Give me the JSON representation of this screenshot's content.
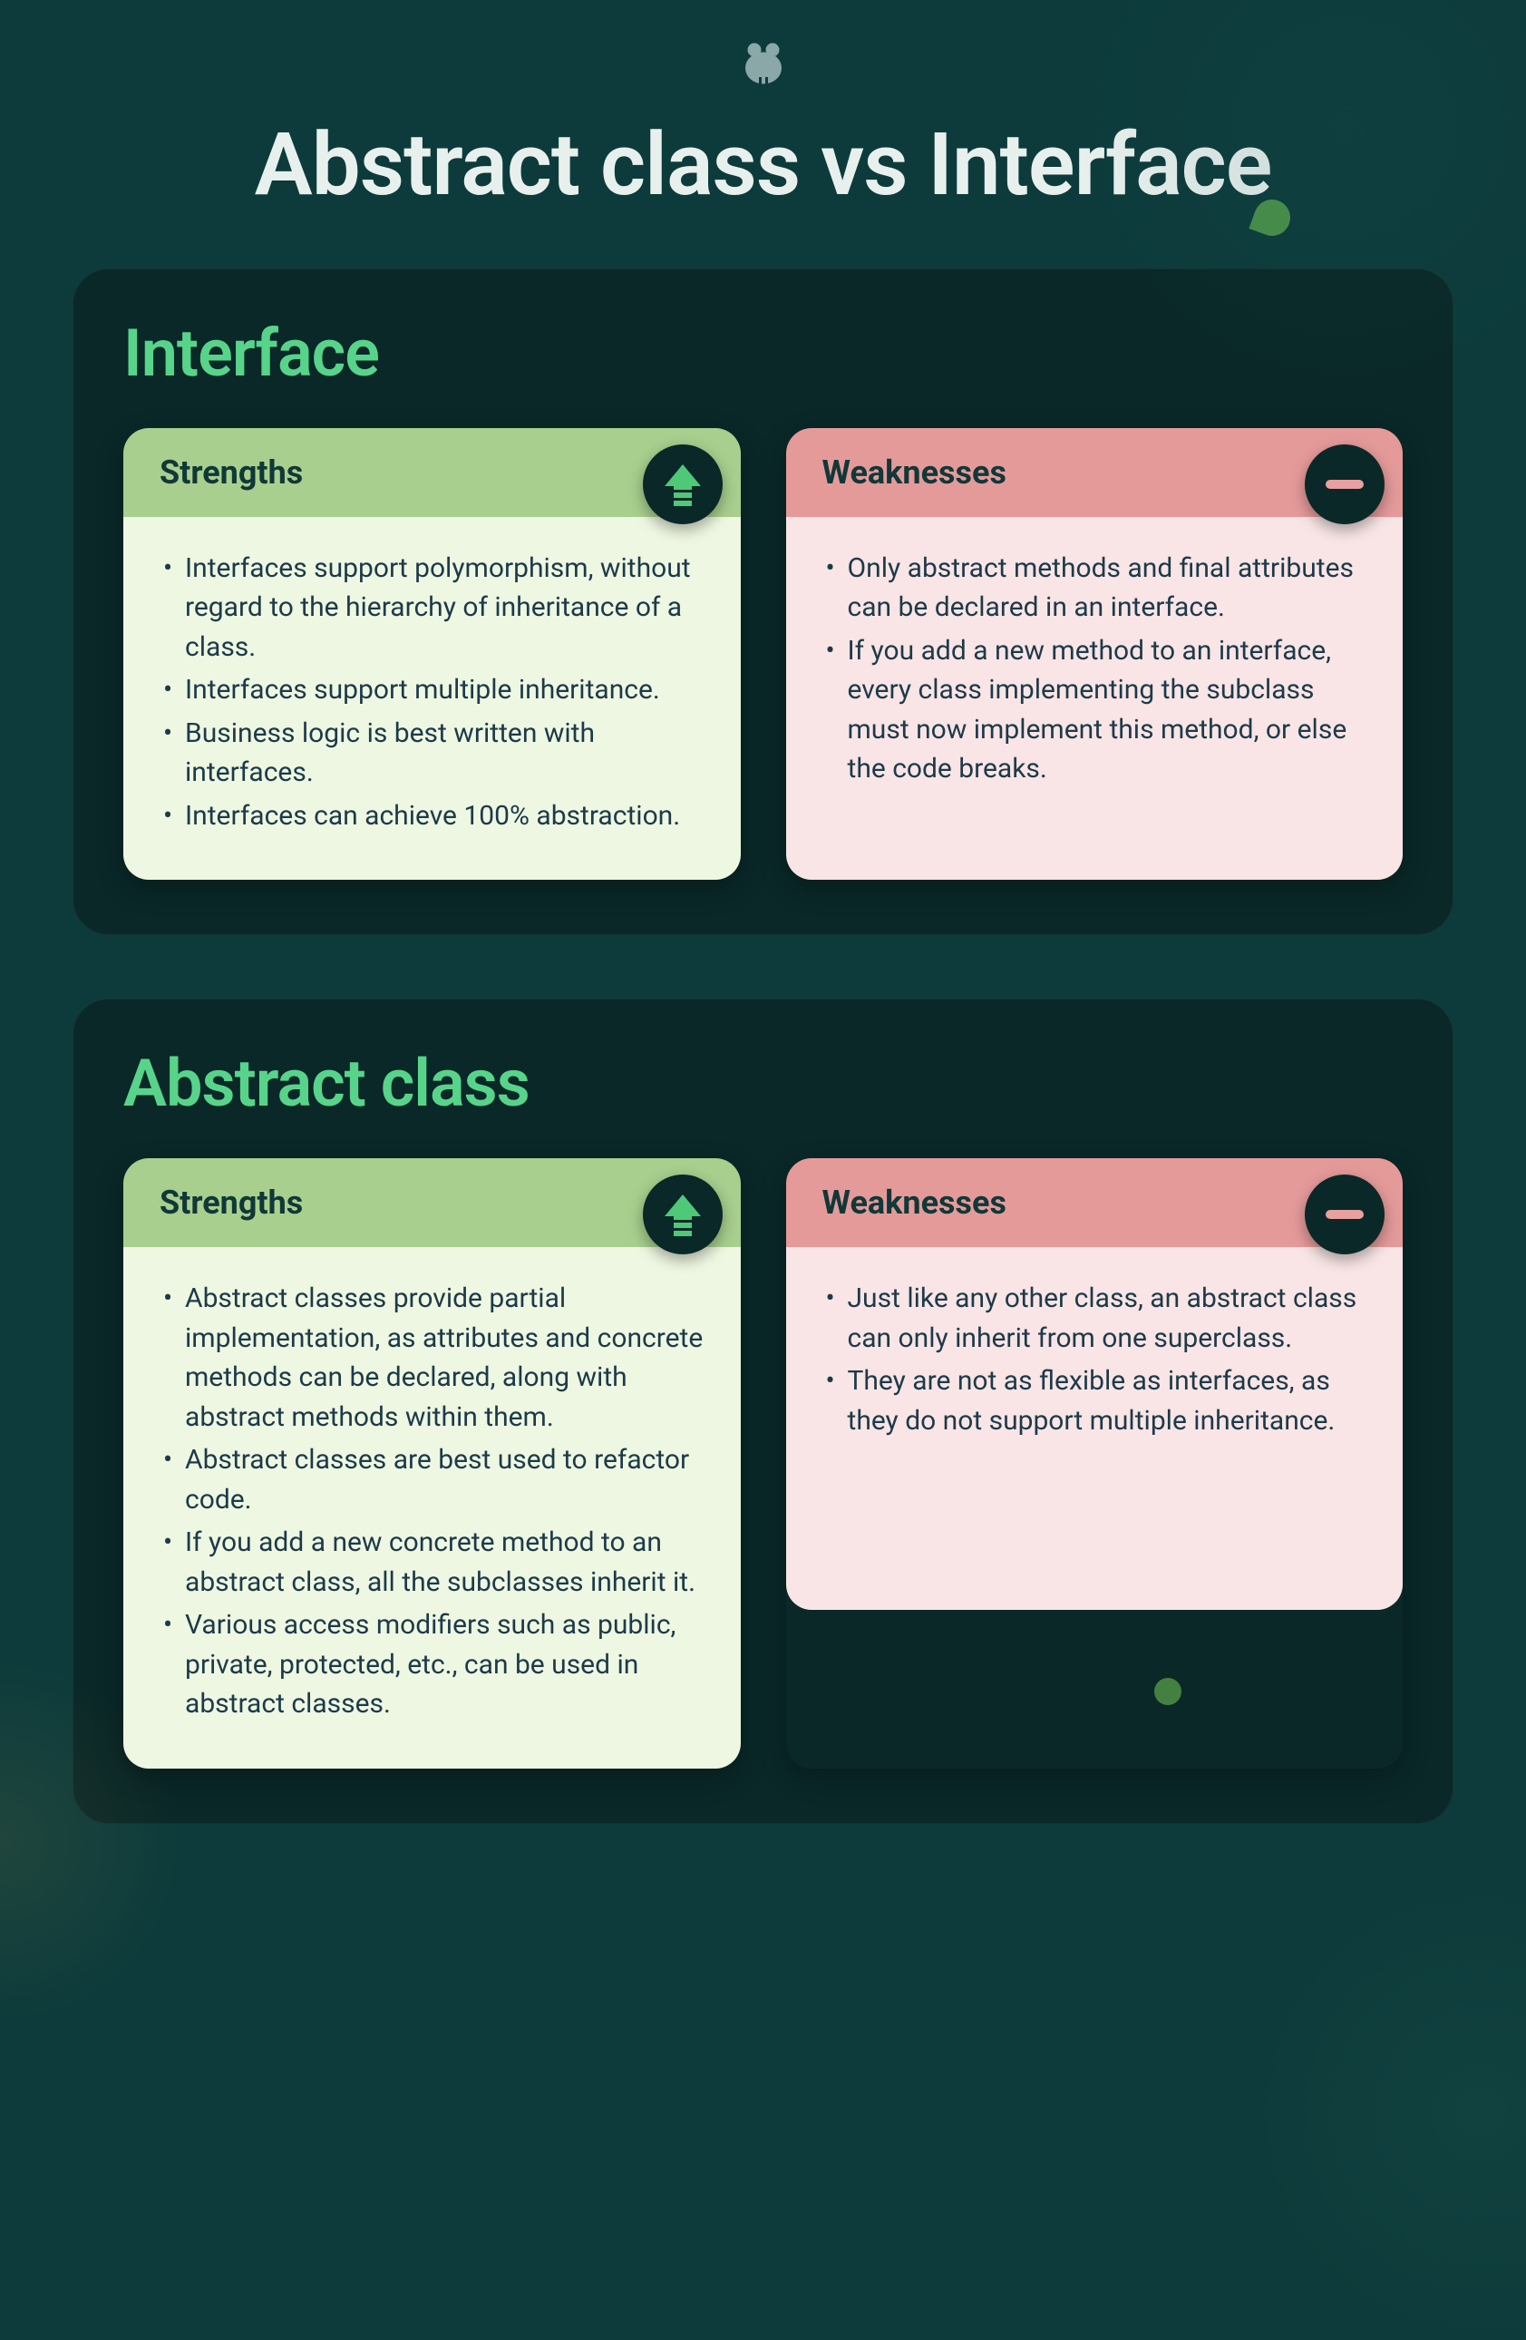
{
  "title": "Abstract class vs Interface",
  "sections": [
    {
      "name": "Interface",
      "strengths": {
        "label": "Strengths",
        "items": [
          "Interfaces support polymorphism, without regard to the hierarchy of inheritance of a class.",
          "Interfaces support multiple inheritance.",
          "Business logic is best written with interfaces.",
          "Interfaces can achieve 100% abstraction."
        ]
      },
      "weaknesses": {
        "label": "Weaknesses",
        "items": [
          "Only abstract methods and final attributes can be declared in an interface.",
          "If you add a new method to an interface, every class implementing the subclass must now implement this method, or else the code breaks."
        ]
      }
    },
    {
      "name": "Abstract class",
      "strengths": {
        "label": "Strengths",
        "items": [
          "Abstract classes provide partial implementation, as attributes and concrete methods can be declared, along with abstract methods within them.",
          "Abstract classes are best used to refactor code.",
          "If you add a new concrete method to an abstract class, all the subclasses inherit it.",
          "Various access modifiers such as public, private, protected, etc., can be used in abstract classes."
        ]
      },
      "weaknesses": {
        "label": "Weaknesses",
        "items": [
          "Just like any other class, an abstract class can only inherit from one superclass.",
          "They are not as flexible as interfaces, as they do not support multiple inheritance."
        ]
      }
    }
  ]
}
